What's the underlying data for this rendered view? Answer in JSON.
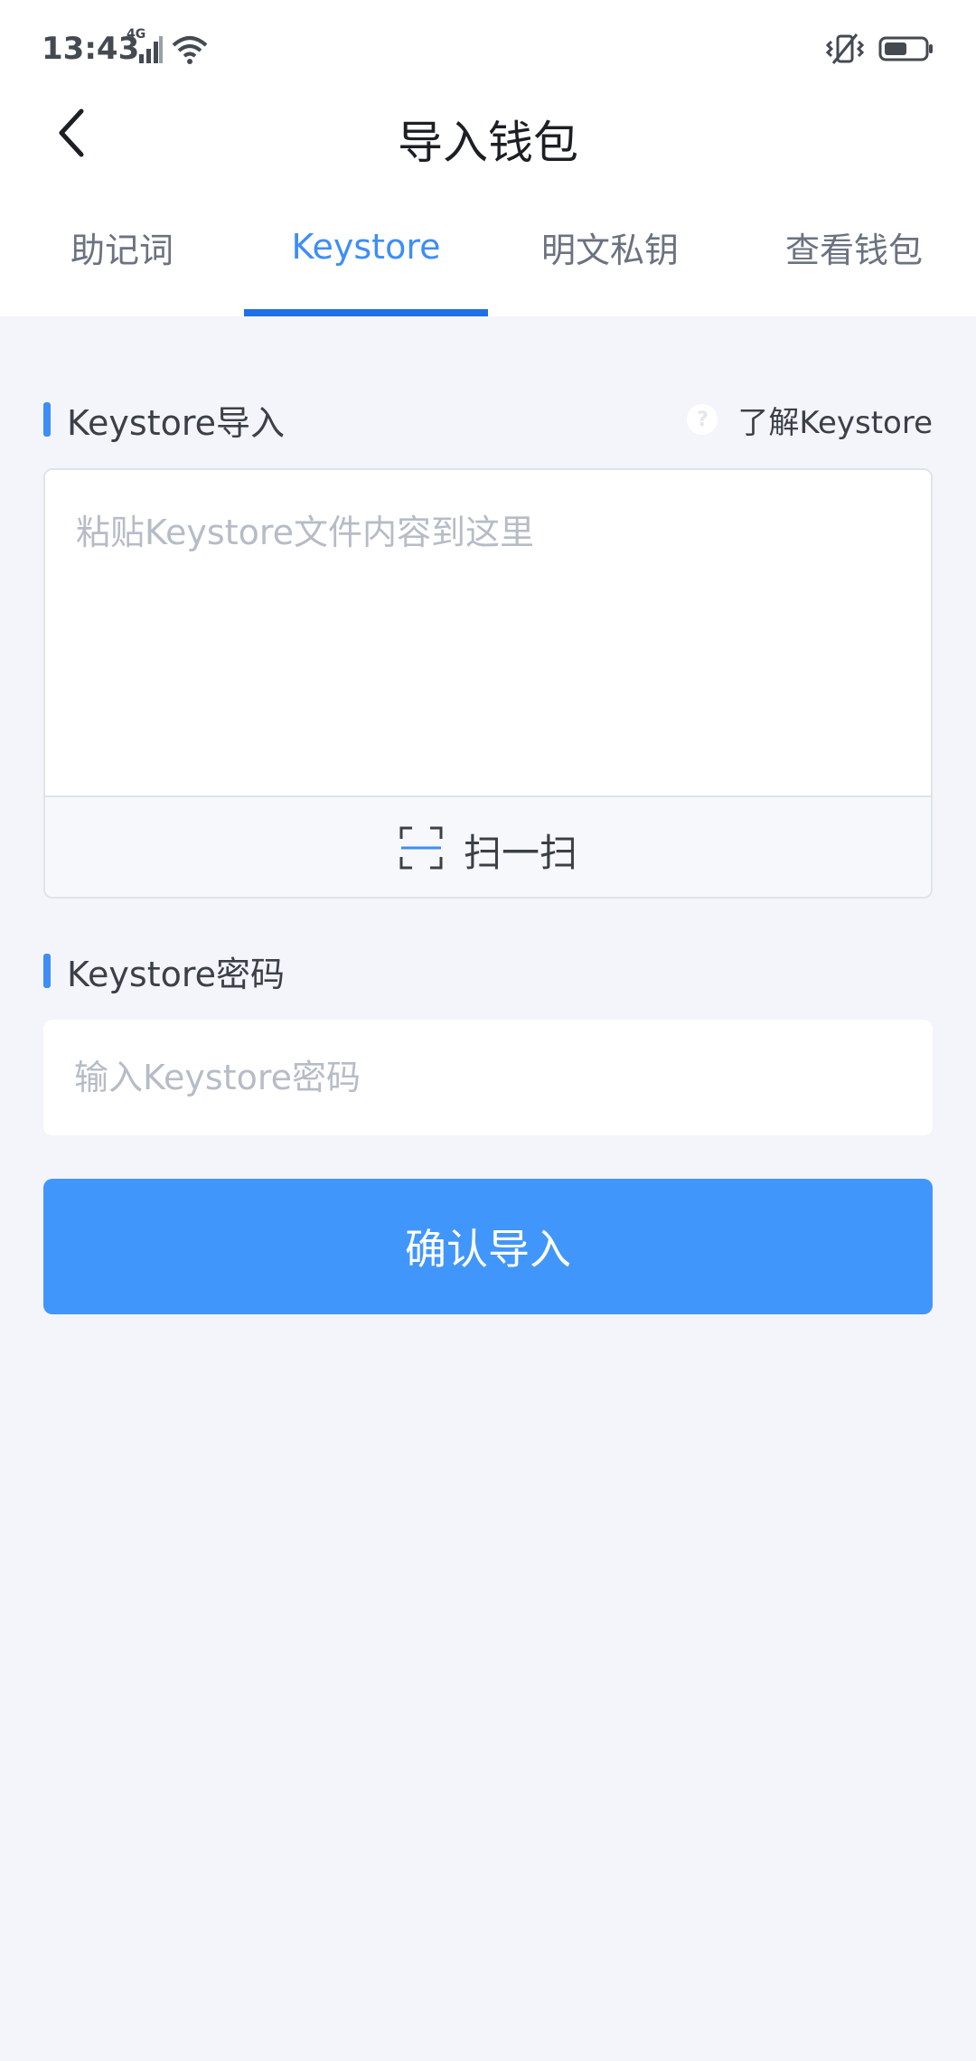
{
  "status_bar": {
    "time": "13:43",
    "network_label": "4G",
    "icons": [
      "signal-icon",
      "wifi-icon",
      "vibrate-icon",
      "battery-icon"
    ]
  },
  "header": {
    "title": "导入钱包",
    "back_icon": "chevron-left-icon"
  },
  "tabs": [
    {
      "label": "助记词",
      "active": false
    },
    {
      "label": "Keystore",
      "active": true
    },
    {
      "label": "明文私钥",
      "active": false
    },
    {
      "label": "查看钱包",
      "active": false
    }
  ],
  "keystore_section": {
    "title": "Keystore导入",
    "help_link": "了解Keystore",
    "help_icon": "question-icon",
    "textarea_placeholder": "粘贴Keystore文件内容到这里",
    "textarea_value": "",
    "scan_label": "扫一扫",
    "scan_icon": "scan-icon"
  },
  "password_section": {
    "title": "Keystore密码",
    "input_placeholder": "输入Keystore密码",
    "input_value": ""
  },
  "confirm_button": {
    "label": "确认导入"
  },
  "colors": {
    "accent": "#3d8ef7",
    "tab_underline": "#1f6fe9",
    "button": "#4196fb",
    "background": "#f4f5fa"
  }
}
